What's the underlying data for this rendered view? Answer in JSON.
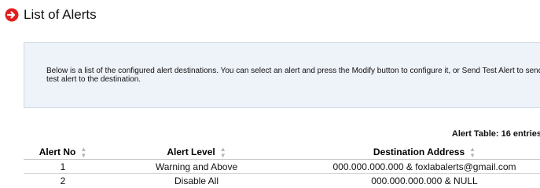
{
  "page": {
    "title": "List of Alerts",
    "title_icon": "arrow-circle-right-icon",
    "accent_color": "#e02020"
  },
  "info": {
    "text": "Below is a list of the configured alert destinations. You can select an alert and press the Modify button to configure it, or Send Test Alert to send a test alert to the destination."
  },
  "table": {
    "caption": "Alert Table: 16 entries",
    "columns": {
      "no": "Alert No",
      "level": "Alert Level",
      "destination": "Destination Address"
    },
    "rows": [
      {
        "no": "1",
        "level": "Warning and Above",
        "destination": "000.000.000.000 & foxlabalerts@gmail.com"
      },
      {
        "no": "2",
        "level": "Disable All",
        "destination": "000.000.000.000 & NULL"
      }
    ]
  }
}
